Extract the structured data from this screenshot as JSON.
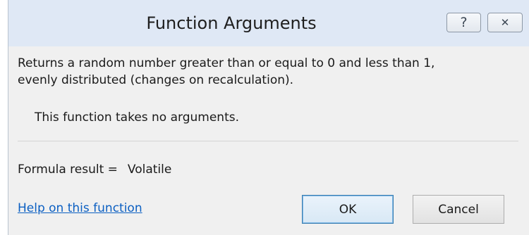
{
  "window": {
    "title": "Function Arguments",
    "help_button": "?",
    "close_button": "✕"
  },
  "content": {
    "description_line1": "Returns a random number greater than or equal to 0 and less than 1,",
    "description_line2": "evenly distributed (changes on recalculation).",
    "no_args_text": "This function takes no arguments.",
    "formula_result_label": "Formula result =",
    "formula_result_value": "Volatile",
    "help_link": "Help on this function"
  },
  "buttons": {
    "ok": "OK",
    "cancel": "Cancel"
  }
}
